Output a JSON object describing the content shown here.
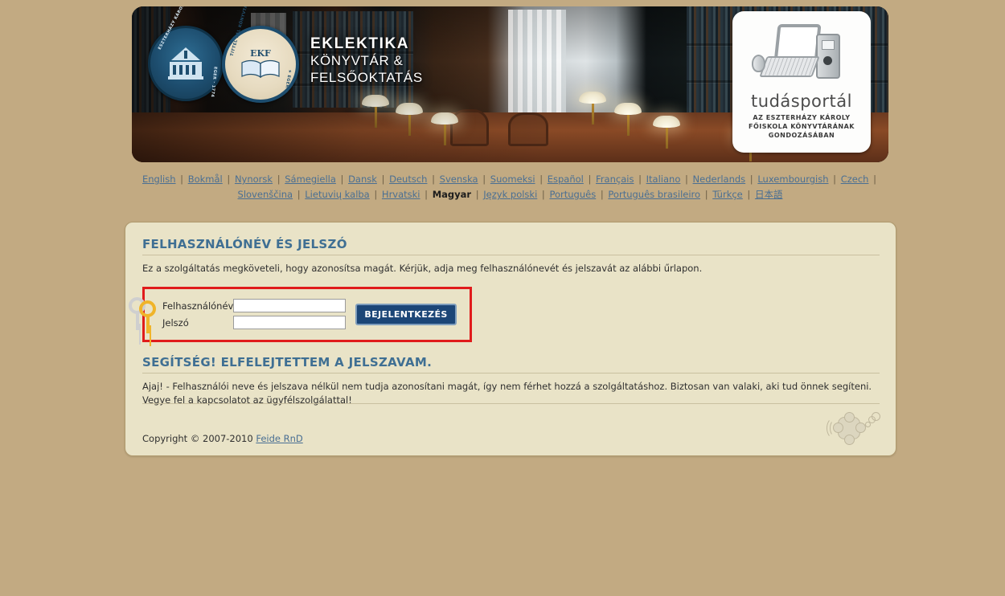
{
  "banner": {
    "title_line1": "EKLEKTIKA",
    "title_line2": "KÖNYVTÁR &",
    "title_line3": "FELSŐOKTATÁS",
    "seal_college_text": "ESZTERHÁZY KÁROLY FŐISKOLA",
    "seal_college_year": "EGER · 1774",
    "seal_library_text": "TITTEL PÁL KÖNYVTÁR ÉS MÉDIACENTRUM",
    "seal_library_abbrev": "EKF",
    "seal_library_city": "★ EGER ★",
    "portal_word": "tudásportál",
    "portal_sub_line1": "AZ ESZTERHÁZY KÁROLY",
    "portal_sub_line2": "FŐISKOLA KÖNYVTÁRÁNAK",
    "portal_sub_line3": "GONDOZÁSÁBAN"
  },
  "languages": {
    "separator": "|",
    "items": [
      {
        "label": "English",
        "current": false
      },
      {
        "label": "Bokmål",
        "current": false
      },
      {
        "label": "Nynorsk",
        "current": false
      },
      {
        "label": "Sámegiella",
        "current": false
      },
      {
        "label": "Dansk",
        "current": false
      },
      {
        "label": "Deutsch",
        "current": false
      },
      {
        "label": "Svenska",
        "current": false
      },
      {
        "label": "Suomeksi",
        "current": false
      },
      {
        "label": "Español",
        "current": false
      },
      {
        "label": "Français",
        "current": false
      },
      {
        "label": "Italiano",
        "current": false
      },
      {
        "label": "Nederlands",
        "current": false
      },
      {
        "label": "Luxembourgish",
        "current": false
      },
      {
        "label": "Czech",
        "current": false
      },
      {
        "label": "Slovenščina",
        "current": false
      },
      {
        "label": "Lietuvių kalba",
        "current": false
      },
      {
        "label": "Hrvatski",
        "current": false
      },
      {
        "label": "Magyar",
        "current": true
      },
      {
        "label": "Język polski",
        "current": false
      },
      {
        "label": "Português",
        "current": false
      },
      {
        "label": "Português brasileiro",
        "current": false
      },
      {
        "label": "Türkçe",
        "current": false
      },
      {
        "label": "日本語",
        "current": false
      }
    ]
  },
  "login": {
    "heading": "FELHASZNÁLÓNÉV ÉS JELSZÓ",
    "lead": "Ez a szolgáltatás megköveteli, hogy azonosítsa magát. Kérjük, adja meg felhasználónevét és jelszavát az alábbi űrlapon.",
    "username_label": "Felhasználónév",
    "username_value": "",
    "username_placeholder": "",
    "password_label": "Jelszó",
    "password_value": "",
    "password_placeholder": "",
    "submit_label": "BEJELENTKEZÉS"
  },
  "help": {
    "heading": "SEGÍTSÉG! ELFELEJTETTEM A JELSZAVAM.",
    "text": "Ajaj! - Felhasználói neve és jelszava nélkül nem tudja azonosítani magát, így nem férhet hozzá a szolgáltatáshoz. Biztosan van valaki, aki tud önnek segíteni. Vegye fel a kapcsolatot az ügyfélszolgálattal!"
  },
  "footer": {
    "copyright": "Copyright © 2007-2010",
    "link_label": "Feide RnD"
  },
  "colors": {
    "page_background": "#c2aa82",
    "card_background": "#e9e3c7",
    "card_border": "#b09a6e",
    "heading": "#3f6f93",
    "link": "#4a6f93",
    "login_box_border": "#e01b1b",
    "submit_background": "#1c4677",
    "submit_text": "#ffffff"
  }
}
